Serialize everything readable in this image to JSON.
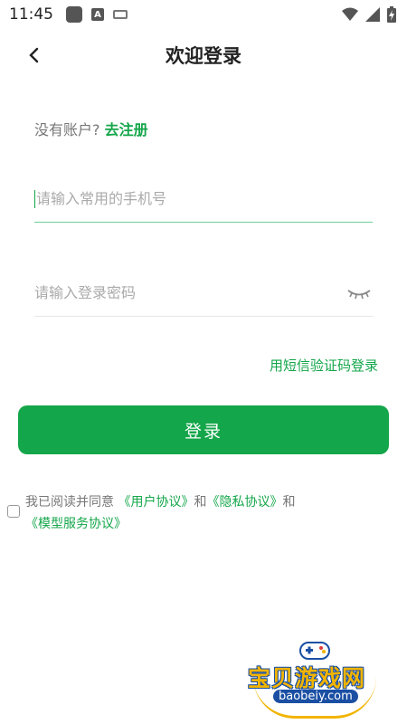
{
  "status_bar": {
    "time": "11:45",
    "a_label": "A"
  },
  "nav": {
    "title": "欢迎登录"
  },
  "register": {
    "prompt": "没有账户?",
    "link": "去注册"
  },
  "phone_field": {
    "placeholder": "请输入常用的手机号",
    "value": ""
  },
  "password_field": {
    "placeholder": "请输入登录密码",
    "value": ""
  },
  "sms_login": "用短信验证码登录",
  "login_button": "登录",
  "agreement": {
    "prefix": "我已阅读并同意",
    "user_agreement": "《用户协议》",
    "and1": "和",
    "privacy_agreement": "《隐私协议》",
    "and2": "和",
    "model_agreement": "《模型服务协议》",
    "checked": false
  },
  "watermark": {
    "title": "宝贝游戏网",
    "url": "baobeiy.com"
  },
  "colors": {
    "accent": "#14a64a",
    "watermark_gold": "#f2b400",
    "watermark_blue": "#1a4fa3"
  }
}
